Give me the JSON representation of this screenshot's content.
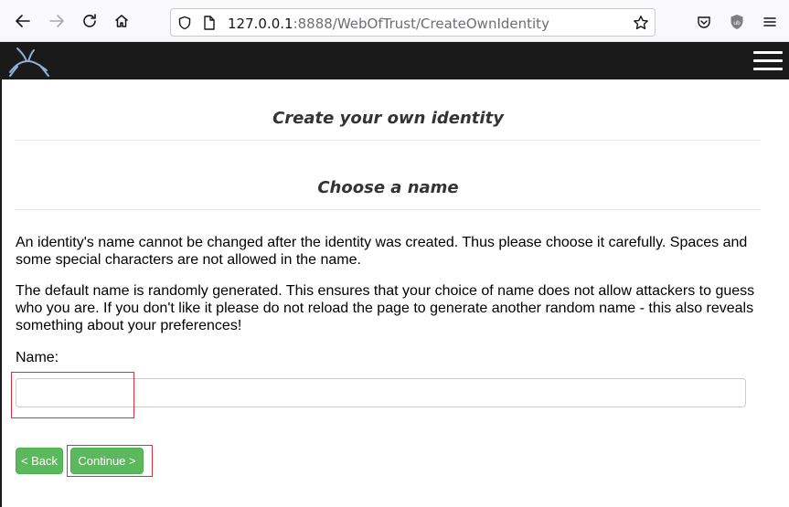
{
  "browser": {
    "url_host": "127.0.0.1",
    "url_rest": ":8888/WebOfTrust/CreateOwnIdentity"
  },
  "page": {
    "main_title": "Create your own identity",
    "section_title": "Choose a name",
    "paragraph_1": "An identity's name cannot be changed after the identity was created. Thus please choose it carefully. Spaces and some special characters are not allowed in the name.",
    "paragraph_2": "The default name is randomly generated. This ensures that your choice of name does not allow attackers to guess who you are. If you don't like it please do not reload the page to generate another random name - this also reveals something about your preferences!",
    "name_label": "Name:",
    "name_value": "",
    "back_label": "< Back",
    "continue_label": "Continue >"
  },
  "colors": {
    "header_bg": "#1a1a1a",
    "button_green": "#5cb85c",
    "annotation_red": "#e0313a"
  },
  "icons": [
    "back-arrow-icon",
    "forward-arrow-icon",
    "reload-icon",
    "home-icon",
    "shield-icon",
    "page-icon",
    "star-icon",
    "pocket-icon",
    "ublock-icon",
    "menu-icon",
    "rabbit-logo",
    "hamburger-icon"
  ]
}
